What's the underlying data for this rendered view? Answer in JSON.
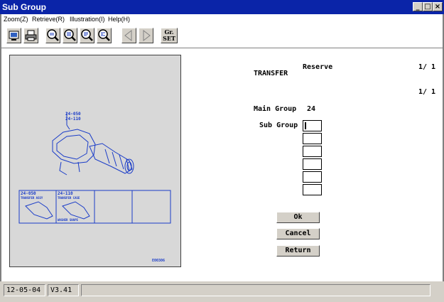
{
  "window": {
    "title": "Sub Group",
    "min": "_",
    "max": "□",
    "close": "×"
  },
  "menu": [
    {
      "label": "Zoom(Z)"
    },
    {
      "label": "Retrieve(R)"
    },
    {
      "label": "Illustration(I)"
    },
    {
      "label": "Help(H)"
    }
  ],
  "toolbar": {
    "buttons": [
      {
        "icon": "monitor-icon"
      },
      {
        "icon": "printer-icon"
      },
      {
        "icon": "zoom-1-icon"
      },
      {
        "icon": "zoom-2-icon"
      },
      {
        "icon": "zoom-3-icon"
      },
      {
        "icon": "zoom-4-icon"
      },
      {
        "icon": "arrow-left-icon"
      },
      {
        "icon": "arrow-right-icon"
      }
    ],
    "grset_line1": "Gr.",
    "grset_line2": "SET"
  },
  "illustration": {
    "label_top1": "24-050",
    "label_top2": "24-110",
    "thumb1_code": "24-050",
    "thumb1_name": "TRANSFER ASSY",
    "thumb2_code": "24-110",
    "thumb2_name": "TRANSFER CASE",
    "thumb2_sub": "WASHER SHAPE",
    "figure_id": "E00306"
  },
  "info": {
    "reserve": "Reserve",
    "page1": "1/ 1",
    "name": "TRANSFER",
    "page2": "1/ 1",
    "main_group_label": "Main Group",
    "main_group_value": "24",
    "sub_group_label": "Sub Group"
  },
  "buttons": {
    "ok": "Ok",
    "cancel": "Cancel",
    "return": "Return"
  },
  "status": {
    "date": "12-05-04",
    "version": "V3.41",
    "message": ""
  }
}
